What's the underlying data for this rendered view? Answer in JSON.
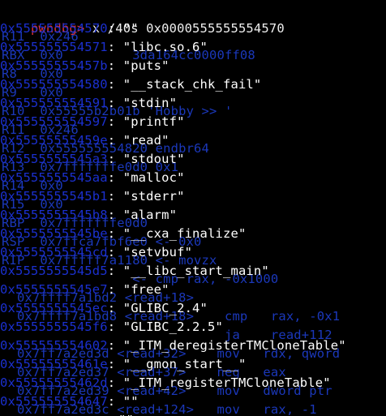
{
  "terminal": {
    "prompt": "pwndbg>",
    "command": " x /40s 0x0000555555554570",
    "rows": [
      {
        "addr": "0x555555554570",
        "value": "\"\""
      },
      {
        "addr": "0x555555554571",
        "value": "\"libc.so.6\""
      },
      {
        "addr": "0x55555555457b",
        "value": "\"puts\""
      },
      {
        "addr": "0x555555554580",
        "value": "\"__stack_chk_fail\""
      },
      {
        "addr": "0x555555554591",
        "value": "\"stdin\""
      },
      {
        "addr": "0x555555554597",
        "value": "\"printf\""
      },
      {
        "addr": "0x55555555459e",
        "value": "\"read\""
      },
      {
        "addr": "0x5555555545a3",
        "value": "\"stdout\""
      },
      {
        "addr": "0x5555555545aa",
        "value": "\"malloc\""
      },
      {
        "addr": "0x5555555545b1",
        "value": "\"stderr\""
      },
      {
        "addr": "0x5555555545b8",
        "value": "\"alarm\""
      },
      {
        "addr": "0x5555555545be",
        "value": "\"__cxa_finalize\""
      },
      {
        "addr": "0x5555555545cd",
        "value": "\"setvbuf\""
      },
      {
        "addr": "0x5555555545d5",
        "value": "\"__libc_start_main\""
      },
      {
        "addr": "0x5555555545e7",
        "value": "\"free\""
      },
      {
        "addr": "0x5555555545ec",
        "value": "\"GLIBC_2.4\""
      },
      {
        "addr": "0x5555555545f6",
        "value": "\"GLIBC_2.2.5\""
      },
      {
        "addr": "0x555555554602",
        "value": "\"_ITM_deregisterTMCloneTable\""
      },
      {
        "addr": "0x55555555461e",
        "value": "\"__gmon_start__\""
      },
      {
        "addr": "0x55555555462d",
        "value": "\"_ITM_registerTMCloneTable\""
      },
      {
        "addr": "0x555555554647",
        "value": "\"\""
      },
      {
        "addr": "",
        "value": "\"\""
      }
    ],
    "ghost": [
      {
        "text": "R11  0x246"
      },
      {
        "text": "RBX  0x0         3da164cc0000ff08"
      },
      {
        "text": "R8   0x0"
      },
      {
        "text": "R9   0x0"
      },
      {
        "text": "R10  0x55555b2b01b 'Hobby >> '"
      },
      {
        "text": "R11  0x246"
      },
      {
        "text": "R12  0x555555554820 endbr64"
      },
      {
        "text": "R13  0x7fffffffe0d0 0x1"
      },
      {
        "text": "R14  0x0"
      },
      {
        "text": "R15  0x0"
      },
      {
        "text": "RBP  0x7fffffffe0d0"
      },
      {
        "text": "RSP  0x7ffca7fbf6e0 <- 0x0"
      },
      {
        "text": "RIP  0x7fffff7a1180 <- movzx"
      },
      {
        "text": "                 <- cmp rax, -0x1000"
      },
      {
        "text": "  0x7ffff7a1bd2 <read+18>"
      },
      {
        "text": "  0x7ffff7a1bd8 <read+18>    cmp   rax, -0x1"
      },
      {
        "text": "                             ja    read+112"
      },
      {
        "text": "  0x7ff7a2ed3d <read+32>    mov   rdx, qword"
      },
      {
        "text": "  0x7ff7a2ed37 <read+37>    neg   eax"
      },
      {
        "text": "  0x7ff7a2ed39 <read+42>    mov   dword ptr"
      },
      {
        "text": "  0x7ff7a2ed3c <read+124>   mov   rax, -1"
      },
      {
        "text": ""
      }
    ]
  }
}
